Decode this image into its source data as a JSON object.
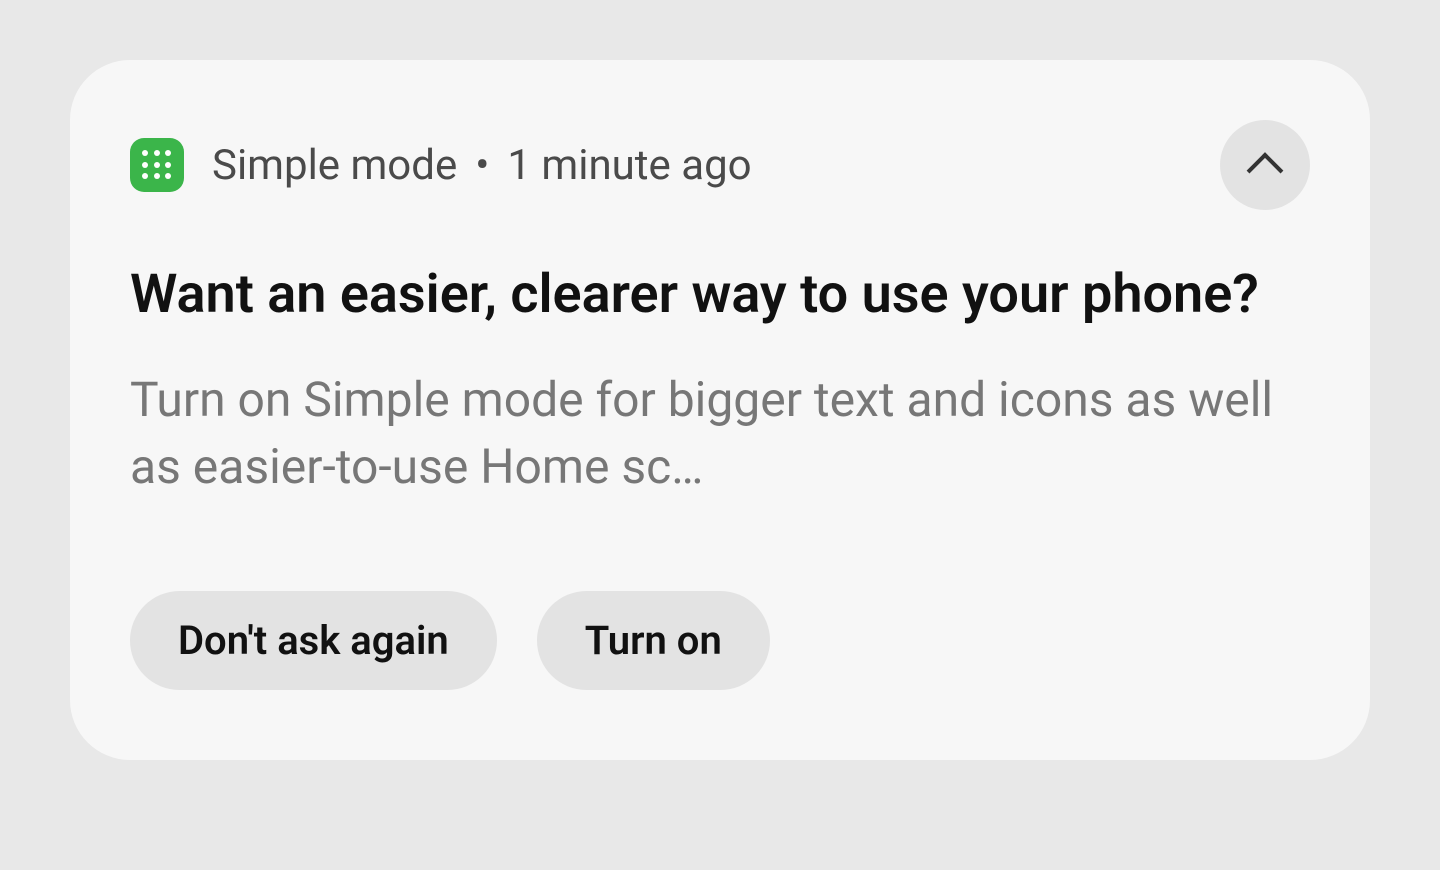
{
  "notification": {
    "app_name": "Simple mode",
    "separator": "•",
    "timestamp": "1 minute ago",
    "title": "Want an easier, clearer way to use your phone?",
    "body": "Turn on Simple mode for bigger text and icons as well as easier-to-use Home sc…",
    "actions": {
      "dismiss": "Don't ask again",
      "confirm": "Turn on"
    },
    "icon_name": "grid-apps-icon",
    "icon_color": "#3bb54a"
  }
}
